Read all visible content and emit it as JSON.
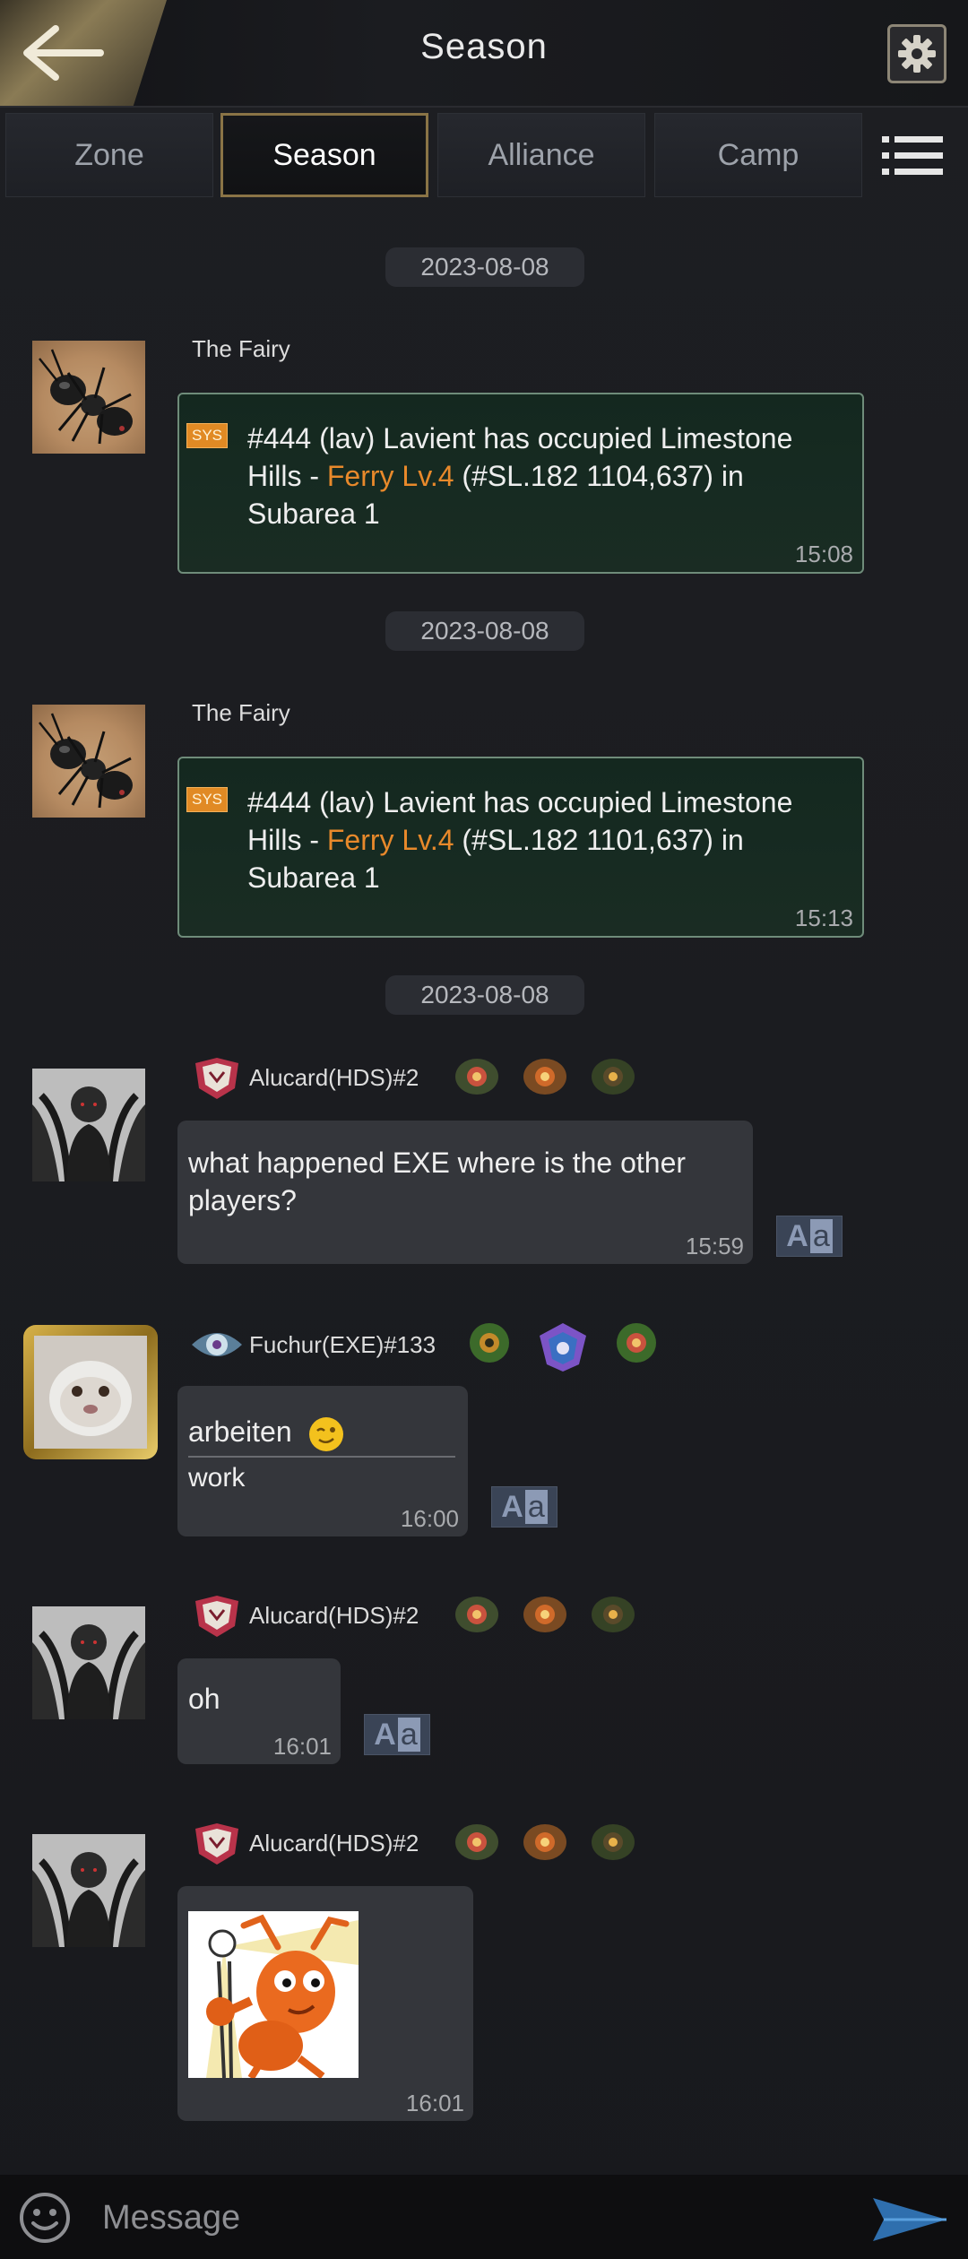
{
  "header": {
    "title": "Season",
    "back_icon": "back-arrow-icon",
    "settings_icon": "gear-icon"
  },
  "tabs": [
    {
      "label": "Zone"
    },
    {
      "label": "Season"
    },
    {
      "label": "Alliance"
    },
    {
      "label": "Camp"
    }
  ],
  "active_tab": "Season",
  "messages": [
    {
      "date": "2023-08-08",
      "sender": "The Fairy",
      "tag": "SYS",
      "text_a": "#444 (lav) Lavient has occupied Limestone Hills - ",
      "highlight": "Ferry Lv.4",
      "text_b": " (#SL.182 1104,637) in Subarea 1",
      "time": "15:08"
    },
    {
      "date": "2023-08-08",
      "sender": "The Fairy",
      "tag": "SYS",
      "text_a": "#444 (lav) Lavient has occupied Limestone Hills - ",
      "highlight": "Ferry Lv.4",
      "text_b": " (#SL.182 1101,637) in Subarea 1",
      "time": "15:13"
    },
    {
      "date": "2023-08-08",
      "sender": "Alucard(HDS)#2",
      "text": "what happened EXE where is the other players?",
      "time": "15:59"
    },
    {
      "sender": "Fuchur(EXE)#133",
      "text": "arbeiten",
      "translation": "work",
      "time": "16:00"
    },
    {
      "sender": "Alucard(HDS)#2",
      "text": "oh",
      "time": "16:01"
    },
    {
      "sender": "Alucard(HDS)#2",
      "sticker": "ant-sticker",
      "time": "16:01"
    }
  ],
  "translate_label": {
    "a": "A",
    "b": "a"
  },
  "input": {
    "placeholder": "Message"
  },
  "colors": {
    "accent": "#e8892b",
    "sys_tag": "#e18a24",
    "active_tab_border": "#8a7446"
  }
}
